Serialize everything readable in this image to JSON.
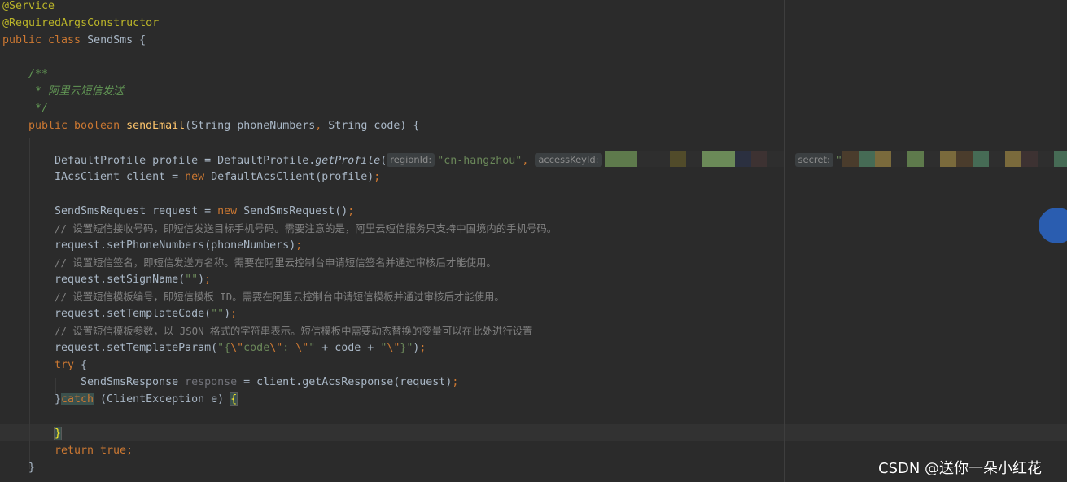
{
  "code": {
    "l1_annotation": "@Service",
    "l2_annotation": "@RequiredArgsConstructor",
    "l3_kw": "public class ",
    "l3_name": "SendSms {",
    "l5_doc": "/**",
    "l6_doc": " * 阿里云短信发送",
    "l7_doc": " */",
    "l8_kw": "public boolean ",
    "l8_fn": "sendEmail",
    "l8_params_a": "(String phoneNumbers",
    "l8_comma": ",",
    "l8_params_b": " String code) {",
    "l10_a": "DefaultProfile profile = DefaultProfile.",
    "l10_fn": "getProfile",
    "l10_paren": "(",
    "l10_hint_region": "regionId:",
    "l10_region_val": "\"cn-hangzhou\"",
    "l10_comma": ",",
    "l10_hint_key": "accessKeyId:",
    "l10_hint_secret": "secret:",
    "l10_secret_quote": "\"",
    "l10_semicolon": ";",
    "l11_a": "IAcsClient client = ",
    "l11_kw": "new",
    "l11_b": " DefaultAcsClient(profile)",
    "l11_semi": ";",
    "l13_a": "SendSmsRequest request = ",
    "l13_kw": "new",
    "l13_b": " SendSmsRequest()",
    "l13_semi": ";",
    "l14_cm": "// 设置短信接收号码，即短信发送目标手机号码。需要注意的是，阿里云短信服务只支持中国境内的手机号码。",
    "l15_a": "request.setPhoneNumbers(phoneNumbers)",
    "l15_semi": ";",
    "l16_cm": "// 设置短信签名，即短信发送方名称。需要在阿里云控制台申请短信签名并通过审核后才能使用。",
    "l17_a": "request.setSignName(",
    "l17_str": "\"\"",
    "l17_b": ")",
    "l17_semi": ";",
    "l18_cm": "// 设置短信模板编号，即短信模板 ID。需要在阿里云控制台申请短信模板并通过审核后才能使用。",
    "l19_a": "request.setTemplateCode(",
    "l19_str": "\"\"",
    "l19_b": ")",
    "l19_semi": ";",
    "l20_cm": "// 设置短信模板参数，以 JSON 格式的字符串表示。短信模板中需要动态替换的变量可以在此处进行设置",
    "l21_a": "request.setTemplateParam(",
    "l21_s1": "\"{",
    "l21_e1": "\\\"",
    "l21_s2": "code",
    "l21_e2": "\\\"",
    "l21_s3": ": ",
    "l21_e3": "\\\"",
    "l21_s4": "\"",
    "l21_mid": " + code + ",
    "l21_s5": "\"",
    "l21_e4": "\\\"",
    "l21_s6": "}\"",
    "l21_b": ")",
    "l21_semi": ";",
    "l22_kw": "try",
    "l22_b": " {",
    "l23_a": "SendSmsResponse ",
    "l23_unused": "response",
    "l23_b": " = client.getAcsResponse(request)",
    "l23_semi": ";",
    "l24_a": "}",
    "l24_kw": "catch",
    "l24_b": " (ClientException e) ",
    "l24_brace": "{",
    "l26_brace": "}",
    "l27_kw": "return true",
    "l27_semi": ";",
    "l28_a": "}"
  },
  "watermark": "CSDN @送你一朵小红花",
  "redaction_colors": [
    "#5e7a4c",
    "#2e2e2e",
    "#514b2a",
    "#6b8a58",
    "#2b3040",
    "#3d3232",
    "#466b55",
    "#4a3c2c",
    "#7a6a3c"
  ]
}
